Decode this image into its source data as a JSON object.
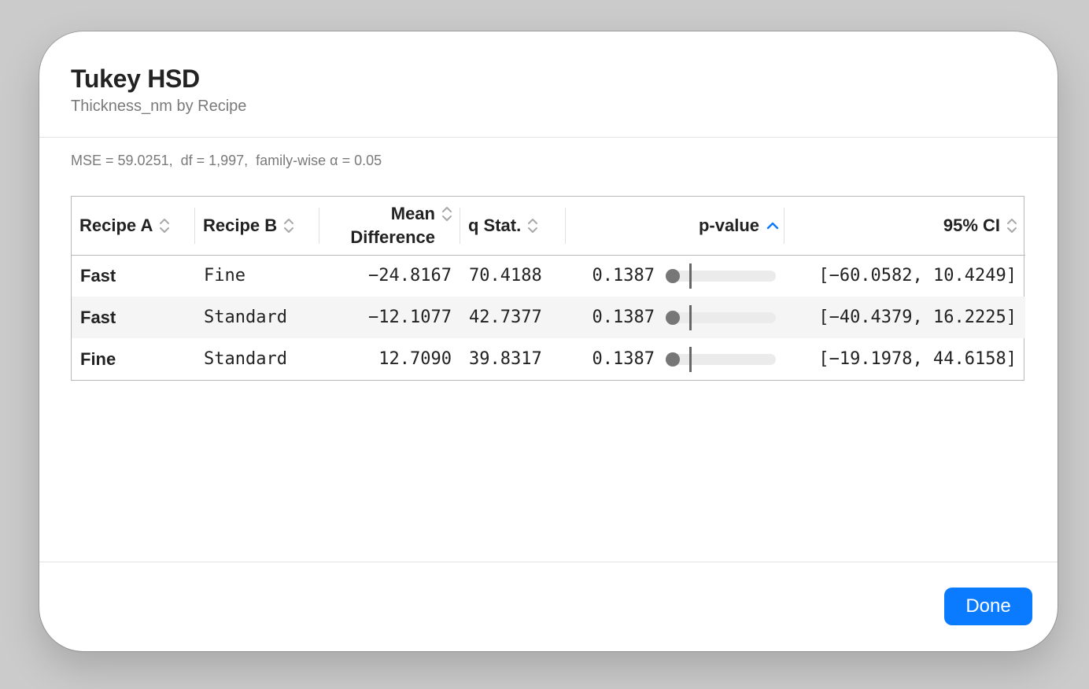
{
  "dialog": {
    "title": "Tukey HSD",
    "subtitle": "Thickness_nm by Recipe",
    "stats": "MSE = 59.0251,  df = 1,997,  family-wise α = 0.05"
  },
  "table": {
    "columns": [
      {
        "label": "Recipe A",
        "sort": "none"
      },
      {
        "label": "Recipe B",
        "sort": "none"
      },
      {
        "label_line1": "Mean",
        "label_line2": "Difference",
        "sort": "none"
      },
      {
        "label": "q Stat.",
        "sort": "none"
      },
      {
        "label": "p-value",
        "sort": "ascending"
      },
      {
        "label": "95% CI",
        "sort": "none"
      }
    ],
    "rows": [
      {
        "a": "Fast",
        "b": "Fine",
        "mean_diff": "−24.8167",
        "q": "70.4188",
        "p": "0.1387",
        "p_fraction": 0.1387,
        "ci": "[−60.0582, 10.4249]"
      },
      {
        "a": "Fast",
        "b": "Standard",
        "mean_diff": "−12.1077",
        "q": "42.7377",
        "p": "0.1387",
        "p_fraction": 0.1387,
        "ci": "[−40.4379, 16.2225]"
      },
      {
        "a": "Fine",
        "b": "Standard",
        "mean_diff": "12.7090",
        "q": "39.8317",
        "p": "0.1387",
        "p_fraction": 0.1387,
        "ci": "[−19.1978, 44.6158]"
      }
    ]
  },
  "footer": {
    "done_label": "Done"
  },
  "colors": {
    "accent": "#0a7aff",
    "sort_active": "#0a7aff",
    "sort_inactive": "#a8a8a8",
    "p_dot": "#777777"
  },
  "icons": {
    "sort_inactive": "chevron-up-down-icon",
    "sort_active": "chevron-up-icon"
  }
}
